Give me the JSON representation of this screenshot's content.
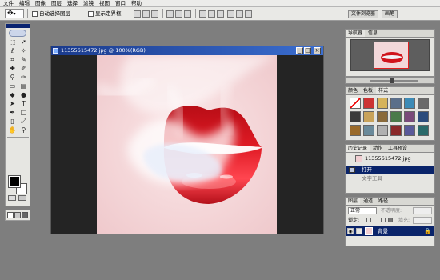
{
  "menubar": {
    "items": [
      "文件",
      "编辑",
      "图像",
      "图层",
      "选择",
      "滤镜",
      "视图",
      "窗口",
      "帮助"
    ]
  },
  "options": {
    "auto_select_label": "自动选择图层",
    "show_bounds_label": "显示定界框",
    "palette_tabs": [
      "文件浏览器",
      "画笔"
    ]
  },
  "document": {
    "title": "11355615472.jpg @ 100%(RGB)"
  },
  "navigator": {
    "tabs": [
      "导航器",
      "信息"
    ]
  },
  "styles": {
    "tabs": [
      "颜色",
      "色板",
      "样式"
    ]
  },
  "history": {
    "tabs": [
      "历史记录",
      "动作",
      "工具预设"
    ],
    "snapshot": "11355615472.jpg",
    "items": [
      "打开",
      "文字工具"
    ],
    "selected_index": 0
  },
  "layers": {
    "tabs": [
      "图层",
      "通道",
      "路径"
    ],
    "blend_mode": "正常",
    "opacity_label": "不透明度:",
    "lock_label": "锁定:",
    "fill_label": "填充:",
    "layer_name": "背景"
  },
  "colors": {
    "fg": "#000000",
    "bg": "#ffffff",
    "title_blue": "#1a3a8c",
    "selection": "#0a246a",
    "lip_red": "#d0141c"
  }
}
